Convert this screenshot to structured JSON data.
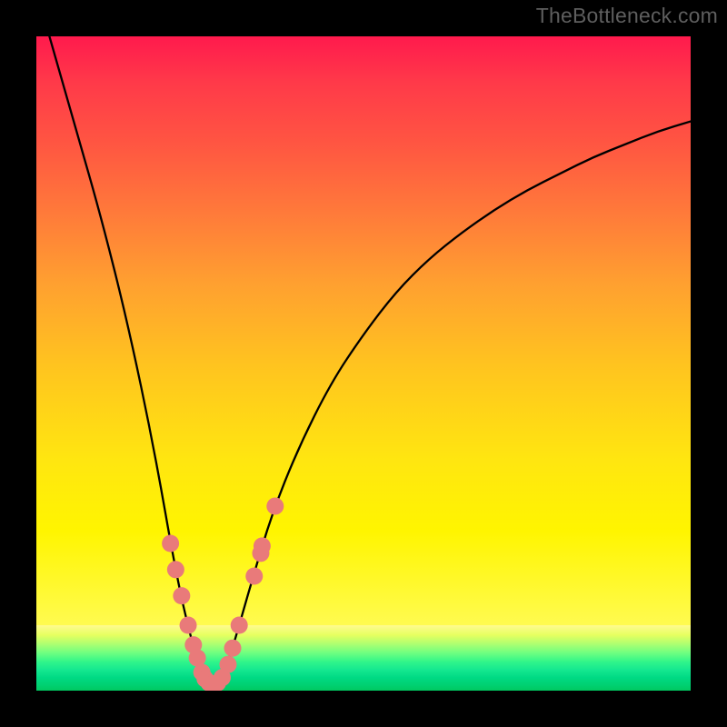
{
  "watermark": "TheBottleneck.com",
  "chart_data": {
    "type": "line",
    "title": "",
    "xlabel": "",
    "ylabel": "",
    "xlim": [
      0,
      1
    ],
    "ylim": [
      0,
      1
    ],
    "curve": {
      "x": [
        0.02,
        0.06,
        0.1,
        0.14,
        0.18,
        0.215,
        0.24,
        0.255,
        0.27,
        0.285,
        0.3,
        0.33,
        0.36,
        0.4,
        0.45,
        0.5,
        0.55,
        0.6,
        0.65,
        0.7,
        0.75,
        0.8,
        0.85,
        0.9,
        0.95,
        1.0
      ],
      "y": [
        1.0,
        0.86,
        0.72,
        0.56,
        0.37,
        0.17,
        0.065,
        0.02,
        0.01,
        0.02,
        0.065,
        0.17,
        0.27,
        0.37,
        0.47,
        0.545,
        0.61,
        0.66,
        0.7,
        0.735,
        0.765,
        0.79,
        0.815,
        0.835,
        0.855,
        0.87
      ]
    },
    "dots": [
      {
        "x": 0.205,
        "y": 0.225
      },
      {
        "x": 0.213,
        "y": 0.185
      },
      {
        "x": 0.222,
        "y": 0.145
      },
      {
        "x": 0.232,
        "y": 0.1
      },
      {
        "x": 0.24,
        "y": 0.07
      },
      {
        "x": 0.246,
        "y": 0.05
      },
      {
        "x": 0.253,
        "y": 0.028
      },
      {
        "x": 0.258,
        "y": 0.018
      },
      {
        "x": 0.264,
        "y": 0.012
      },
      {
        "x": 0.27,
        "y": 0.01
      },
      {
        "x": 0.277,
        "y": 0.012
      },
      {
        "x": 0.284,
        "y": 0.02
      },
      {
        "x": 0.293,
        "y": 0.04
      },
      {
        "x": 0.3,
        "y": 0.065
      },
      {
        "x": 0.31,
        "y": 0.1
      },
      {
        "x": 0.333,
        "y": 0.175
      },
      {
        "x": 0.343,
        "y": 0.21
      },
      {
        "x": 0.345,
        "y": 0.221
      },
      {
        "x": 0.365,
        "y": 0.282
      }
    ],
    "dot_color": "#e97a7a",
    "curve_color": "#000000",
    "curve_width": 2.3,
    "gradient_stops_main": [
      {
        "pos": 0.0,
        "color": "#ff1a4d"
      },
      {
        "pos": 0.08,
        "color": "#ff3a49"
      },
      {
        "pos": 0.18,
        "color": "#ff5542"
      },
      {
        "pos": 0.3,
        "color": "#ff7a3a"
      },
      {
        "pos": 0.42,
        "color": "#ffa030"
      },
      {
        "pos": 0.56,
        "color": "#ffc41f"
      },
      {
        "pos": 0.72,
        "color": "#ffe610"
      },
      {
        "pos": 0.84,
        "color": "#fff500"
      },
      {
        "pos": 1.0,
        "color": "#fffb50"
      }
    ],
    "gradient_stops_green": [
      {
        "pos": 0.0,
        "color": "#fffb90"
      },
      {
        "pos": 0.15,
        "color": "#e6ff60"
      },
      {
        "pos": 0.28,
        "color": "#b0ff70"
      },
      {
        "pos": 0.42,
        "color": "#70ff80"
      },
      {
        "pos": 0.56,
        "color": "#30f58a"
      },
      {
        "pos": 0.68,
        "color": "#15e890"
      },
      {
        "pos": 0.8,
        "color": "#00da84"
      },
      {
        "pos": 0.92,
        "color": "#00d070"
      },
      {
        "pos": 1.0,
        "color": "#00c860"
      }
    ]
  }
}
